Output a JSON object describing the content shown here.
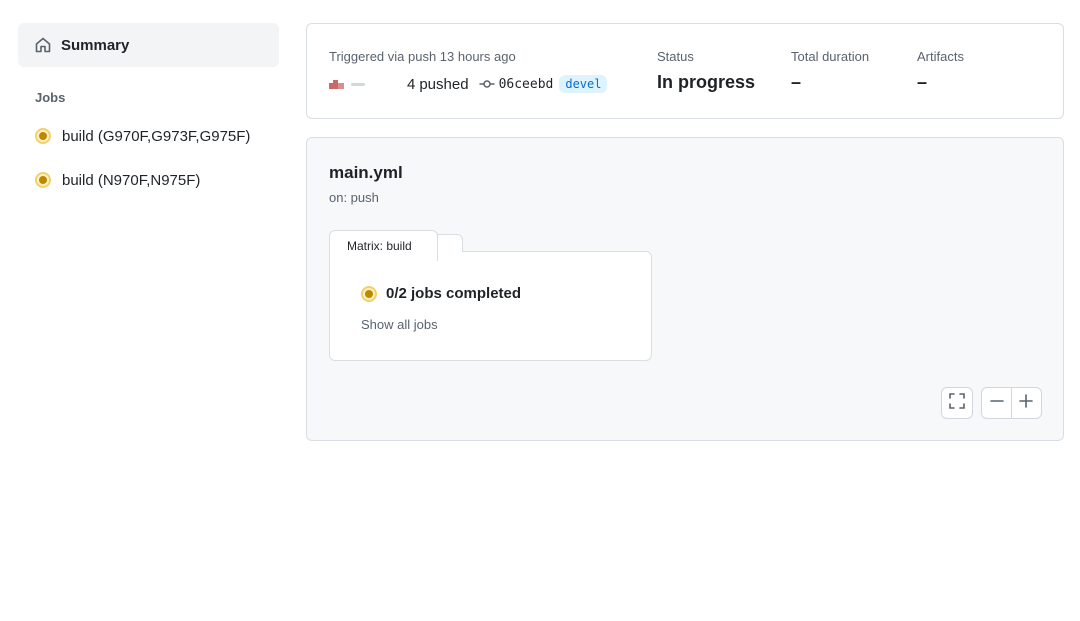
{
  "sidebar": {
    "summary_label": "Summary",
    "jobs_heading": "Jobs",
    "jobs": [
      {
        "label": "build (G970F,G973F,G975F)",
        "status": "in-progress"
      },
      {
        "label": "build (N970F,N975F)",
        "status": "in-progress"
      }
    ]
  },
  "run": {
    "triggered": "Triggered via push 13 hours ago",
    "actor_suffix": "4",
    "pushed": "pushed",
    "commit_sha": "06ceebd",
    "branch": "devel",
    "status_label": "Status",
    "status_value": "In progress",
    "duration_label": "Total duration",
    "duration_value": "–",
    "artifacts_label": "Artifacts",
    "artifacts_value": "–"
  },
  "workflow": {
    "file": "main.yml",
    "trigger": "on: push",
    "matrix_tab": "Matrix: build",
    "jobs_completed": "0/2 jobs completed",
    "show_all": "Show all jobs"
  },
  "colors": {
    "in_progress": "#bf8700",
    "branch_text": "#0969da",
    "branch_bg": "#ddf4ff",
    "card_bg": "#f6f8fa",
    "border": "#d8dee4"
  },
  "icons": {
    "summary": "home-icon",
    "commit": "git-commit-icon",
    "fit": "fullscreen-icon",
    "zoom_out": "minus-icon",
    "zoom_in": "plus-icon",
    "status": "in-progress-dot-icon"
  }
}
